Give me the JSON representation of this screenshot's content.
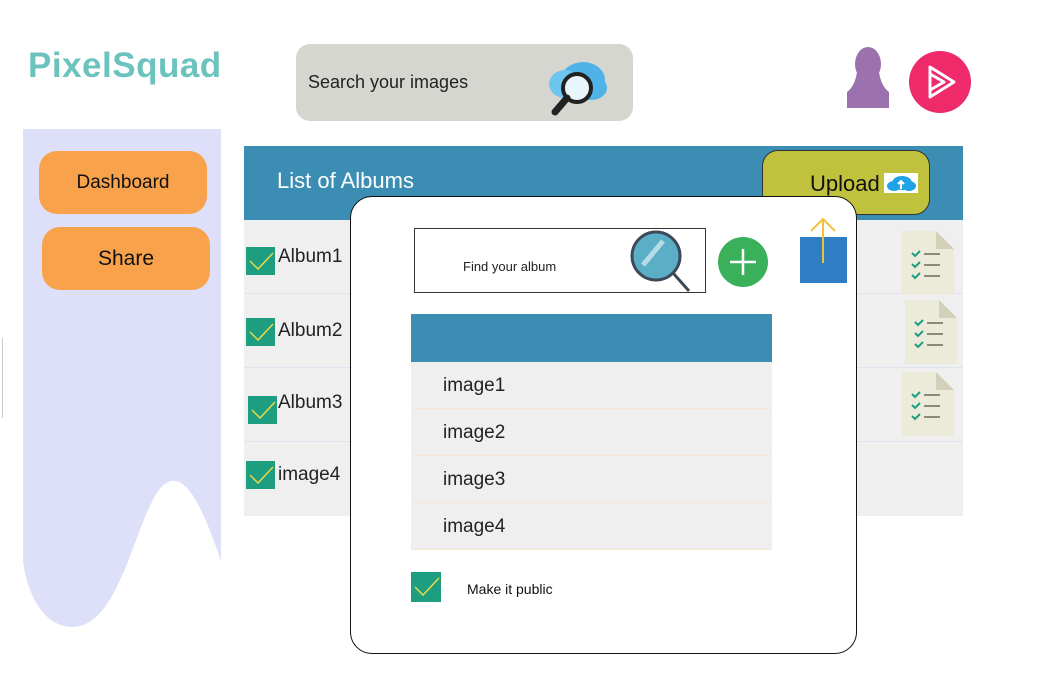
{
  "app": {
    "title": "PixelSquad"
  },
  "search": {
    "placeholder": "Search your images"
  },
  "sidebar": {
    "items": [
      {
        "label": "Dashboard"
      },
      {
        "label": "Share"
      }
    ]
  },
  "albums": {
    "title": "List of Albums",
    "upload_label": "Upload",
    "rows": [
      {
        "label": "Album1",
        "checked": true
      },
      {
        "label": "Album2",
        "checked": true
      },
      {
        "label": "Album3",
        "checked": true
      },
      {
        "label": "image4",
        "checked": true
      }
    ]
  },
  "modal": {
    "find_placeholder": "Find your album",
    "images": [
      "image1",
      "image2",
      "image3",
      "image4"
    ],
    "public_label": "Make it public",
    "public_checked": true
  },
  "colors": {
    "brand": "#6cc3be",
    "header_blue": "#3b8db4",
    "nav_orange": "#f8a24c",
    "upload_olive": "#c0c23e",
    "check_teal": "#1e9e80",
    "add_green": "#3bb05a",
    "play_pink": "#ef2a6a",
    "user_purple": "#9b72ad",
    "sidebar_lavender": "#dedff9"
  }
}
